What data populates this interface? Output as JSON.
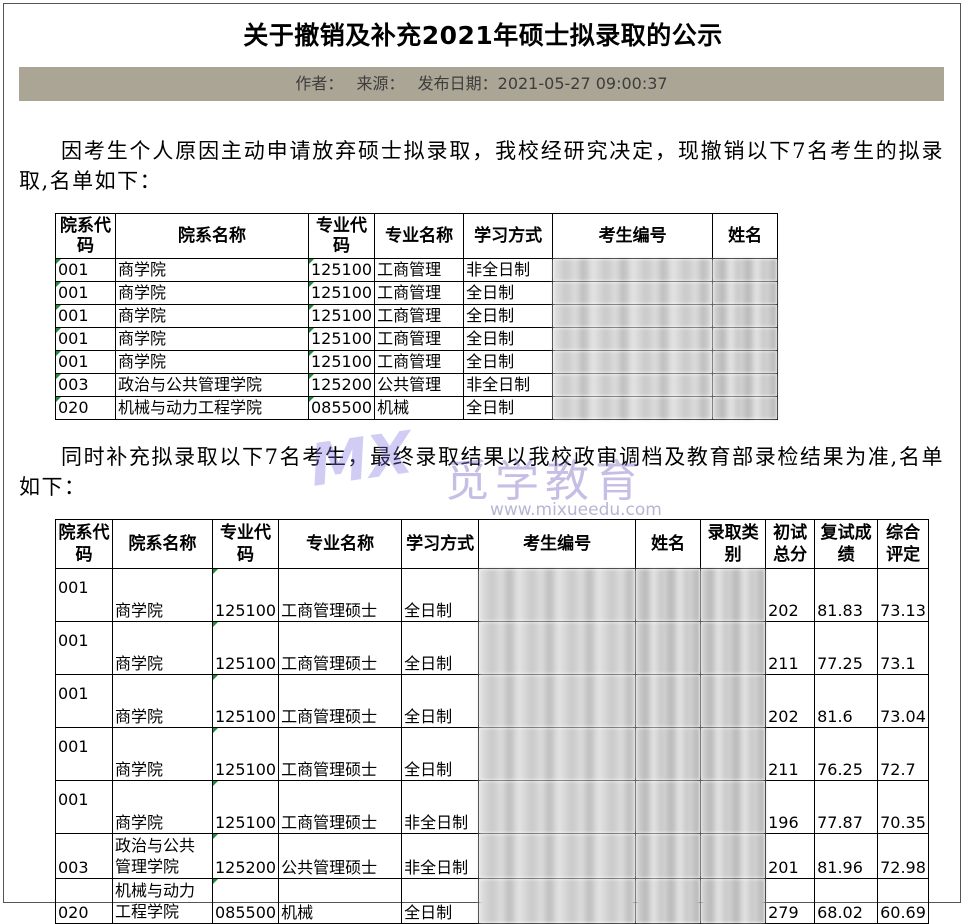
{
  "title": "关于撤销及补充2021年硕士拟录取的公示",
  "meta": {
    "author": "作者：",
    "source": "来源：",
    "date": "发布日期：2021-05-27 09:00:37"
  },
  "para1": "因考生个人原因主动申请放弃硕士拟录取，我校经研究决定，现撤销以下7名考生的拟录取,名单如下：",
  "para2": "同时补充拟录取以下7名考生，最终录取结果以我校政审调档及教育部录检结果为准,名单如下：",
  "table1": {
    "headers": [
      "院系代码",
      "院系名称",
      "专业代码",
      "专业名称",
      "学习方式",
      "考生编号",
      "姓名"
    ],
    "rows": [
      [
        "001",
        "商学院",
        "125100",
        "工商管理",
        "非全日制"
      ],
      [
        "001",
        "商学院",
        "125100",
        "工商管理",
        "全日制"
      ],
      [
        "001",
        "商学院",
        "125100",
        "工商管理",
        "全日制"
      ],
      [
        "001",
        "商学院",
        "125100",
        "工商管理",
        "全日制"
      ],
      [
        "001",
        "商学院",
        "125100",
        "工商管理",
        "全日制"
      ],
      [
        "003",
        "政治与公共管理学院",
        "125200",
        "公共管理",
        "非全日制"
      ],
      [
        "020",
        "机械与动力工程学院",
        "085500",
        "机械",
        "全日制"
      ]
    ]
  },
  "table2": {
    "headers": [
      "院系代码",
      "院系名称",
      "专业代码",
      "专业名称",
      "学习方式",
      "考生编号",
      "姓名",
      "录取类别",
      "初试总分",
      "复试成绩",
      "综合评定"
    ],
    "rows": [
      [
        "001",
        "商学院",
        "125100",
        "工商管理硕士",
        "全日制",
        "202",
        "81.83",
        "73.13"
      ],
      [
        "001",
        "商学院",
        "125100",
        "工商管理硕士",
        "全日制",
        "211",
        "77.25",
        "73.1"
      ],
      [
        "001",
        "商学院",
        "125100",
        "工商管理硕士",
        "全日制",
        "202",
        "81.6",
        "73.04"
      ],
      [
        "001",
        "商学院",
        "125100",
        "工商管理硕士",
        "全日制",
        "211",
        "76.25",
        "72.7"
      ],
      [
        "001",
        "商学院",
        "125100",
        "工商管理硕士",
        "非全日制",
        "196",
        "77.87",
        "70.35"
      ],
      [
        "003",
        "政治与公共管理学院",
        "125200",
        "公共管理硕士",
        "非全日制",
        "201",
        "81.96",
        "72.98"
      ],
      [
        "020",
        "机械与动力工程学院",
        "085500",
        "机械",
        "全日制",
        "279",
        "68.02",
        "60.69"
      ]
    ]
  },
  "watermark": {
    "logo": "MX",
    "text": "觅学教育",
    "url": "www.mixueedu.com"
  }
}
